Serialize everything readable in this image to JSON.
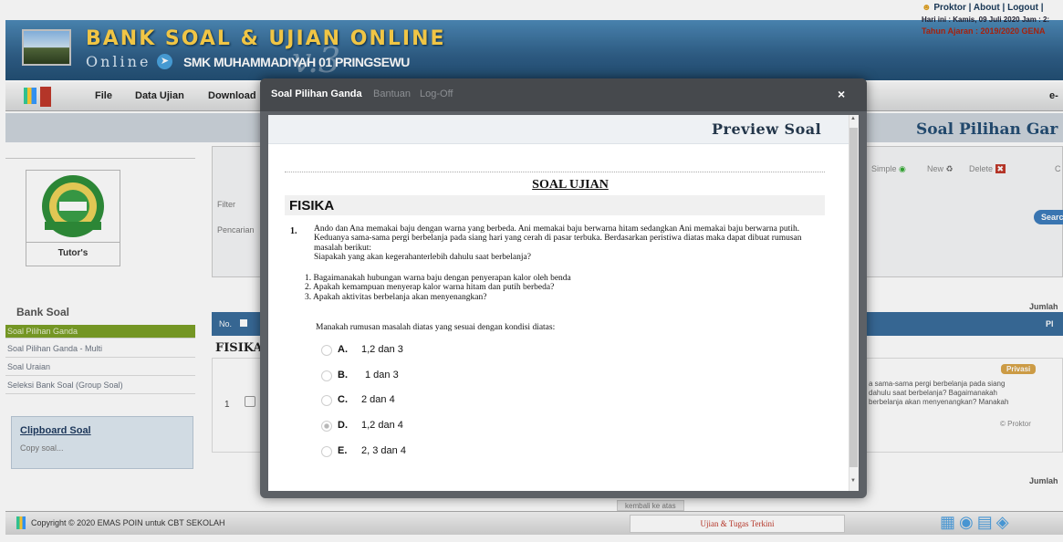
{
  "header": {
    "title": "BANK SOAL & UJIAN ONLINE",
    "online_word": "Online",
    "school": "SMK MUHAMMADIYAH 01 PRINGSEWU",
    "version": "v.3",
    "top_links": "Proktor | About | Logout |",
    "date_info": "Hari ini : Kamis, 09 Juli 2020 Jam : 2:",
    "academic_year": "Tahun Ajaran : 2019/2020 GENA"
  },
  "menu": {
    "items": [
      "File",
      "Data Ujian",
      "Download",
      "Bantuan",
      "Log-Off"
    ],
    "right_text": "e-"
  },
  "page_title": "Soal Pilihan Gar",
  "toolbar": {
    "simple": "Simple",
    "new": "New",
    "delete": "Delete",
    "last": "C"
  },
  "filter": {
    "filter_label": "Filter",
    "search_label": "Pencarian",
    "search_button": "Searc"
  },
  "sidebar": {
    "logo_caption": "Tutor's",
    "section_title": "Bank Soal",
    "items": [
      {
        "label": "Soal Pilihan Ganda"
      },
      {
        "label": "Soal Pilihan Ganda - Multi"
      },
      {
        "label": "Soal Uraian"
      },
      {
        "label": "Seleksi Bank Soal (Group Soal)"
      }
    ],
    "clipboard_title": "Clipboard Soal",
    "clipboard_text": "Copy soal..."
  },
  "table": {
    "jumlah_top": "Jumlah",
    "jumlah_bottom": "Jumlah",
    "col_no": "No.",
    "col_right": "Pl",
    "group_label": "FISIKA --",
    "row": {
      "num": "1",
      "badge": "Privasi",
      "text": "a sama-sama pergi berbelanja pada siang dahulu saat berbelanja? Bagaimanakah berbelanja akan menyenangkan? Manakah",
      "owner": "© Proktor"
    }
  },
  "modal": {
    "title": "Soal Pilihan Ganda",
    "close": "×",
    "preview_title": "Preview Soal",
    "heading": "SOAL UJIAN",
    "subject": "FISIKA",
    "question_number": "1.",
    "question_body": "Ando dan Ana memakai baju dengan warna yang berbeda. Ani memakai baju berwarna hitam sedangkan Ani memakai baju berwarna putih. Keduanya sama-sama pergi berbelanja pada siang hari yang cerah di pasar terbuka. Berdasarkan peristiwa diatas maka dapat dibuat rumusan masalah berikut:",
    "question_sub": "Siapakah yang akan kegerahanterlebih dahulu saat berbelanja?",
    "question_list": [
      "1. Bagaimanakah hubungan warna baju dengan penyerapan kalor oleh benda",
      "2. Apakah kemampuan menyerap kalor warna hitam dan putih berbeda?",
      "3. Apakah aktivitas berbelanja akan menyenangkan?"
    ],
    "prompt": "Manakah rumusan masalah diatas yang sesuai dengan kondisi diatas:",
    "options": [
      {
        "letter": "A.",
        "text": "1,2 dan 3",
        "selected": false
      },
      {
        "letter": "B.",
        "text": "1 dan 3",
        "selected": false
      },
      {
        "letter": "C.",
        "text": "2 dan 4",
        "selected": false
      },
      {
        "letter": "D.",
        "text": "1,2 dan 4",
        "selected": true
      },
      {
        "letter": "E.",
        "text": "2, 3 dan 4",
        "selected": false
      }
    ]
  },
  "footer": {
    "back_to_top": "kembali ke atas",
    "copyright": "Copyright © 2020 EMAS POIN untuk CBT SEKOLAH",
    "center_box": "Ujian & Tugas Terkini"
  },
  "colors": {
    "header_blue": "#2f5f88",
    "title_yellow": "#ffd24a",
    "active_green": "#7ca027",
    "table_head": "#3a6d9c",
    "modal_dark": "#46494d"
  }
}
